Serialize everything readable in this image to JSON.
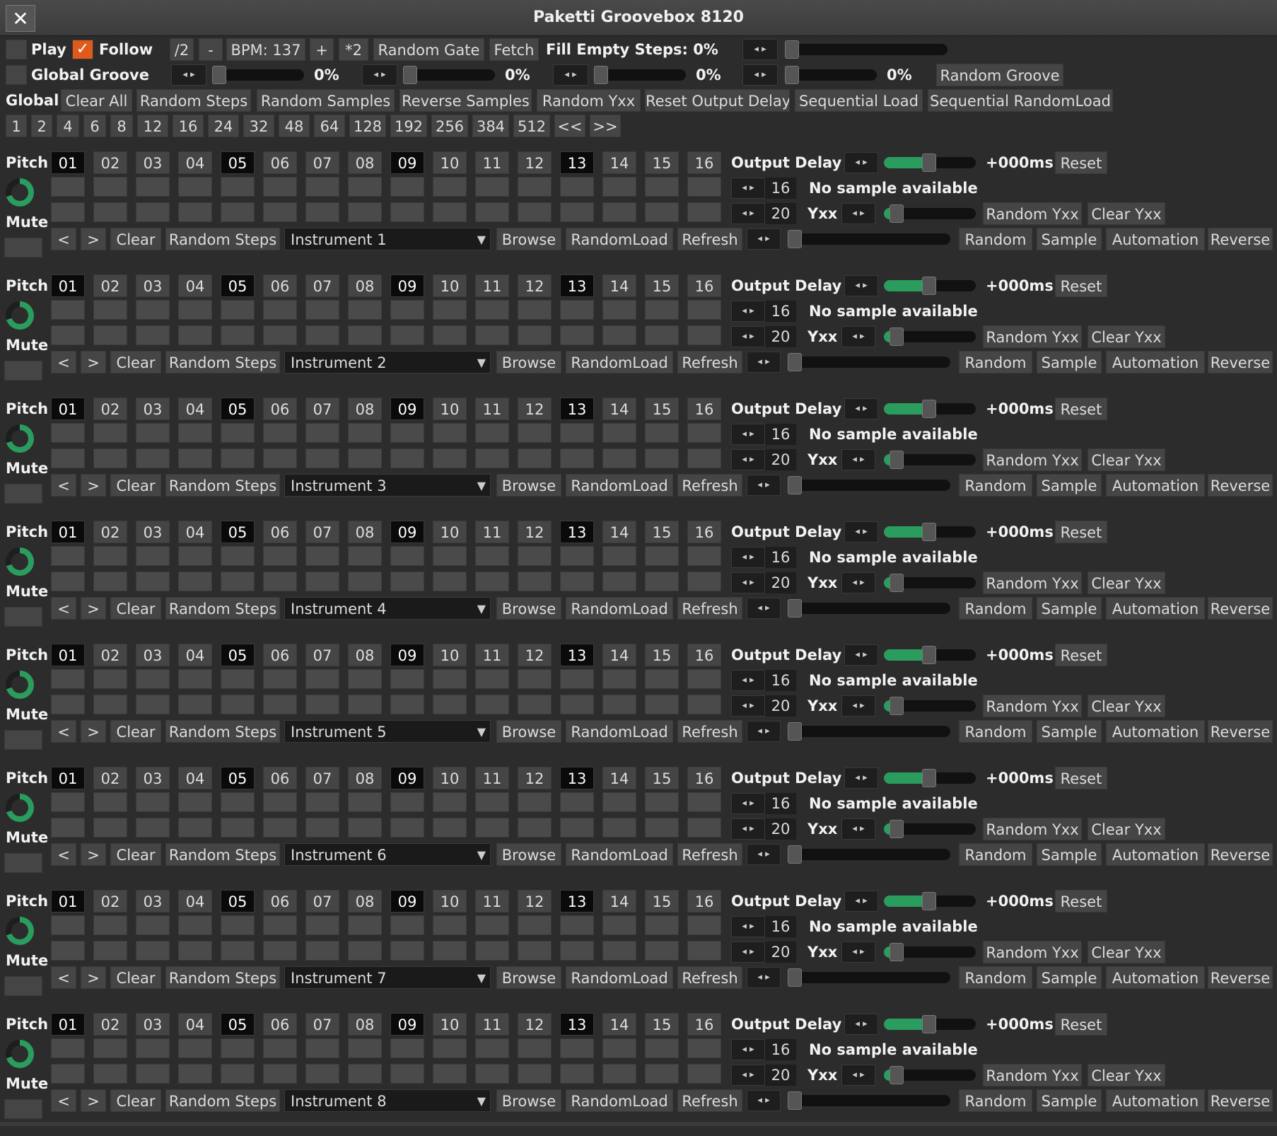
{
  "window": {
    "title": "Paketti Groovebox 8120",
    "close_glyph": "✕"
  },
  "top": {
    "play_label": "Play",
    "play_checked": false,
    "follow_label": "Follow",
    "follow_checked": true,
    "half": "/2",
    "minus": "-",
    "bpm": "BPM: 137",
    "plus": "+",
    "double": "*2",
    "random_gate": "Random Gate",
    "fetch": "Fetch",
    "fill_empty": "Fill Empty Steps: 0%",
    "fill_empty_value": 0,
    "global_groove_label": "Global Groove",
    "global_groove_checked": false,
    "groove_values": [
      "0%",
      "0%",
      "0%",
      "0%"
    ],
    "random_groove": "Random Groove"
  },
  "global_row": {
    "label": "Global",
    "buttons": [
      "Clear All",
      "Random Steps",
      "Random Samples",
      "Reverse Samples",
      "Random Yxx",
      "Reset Output Delay",
      "Sequential Load",
      "Sequential RandomLoad"
    ]
  },
  "step_counts": [
    "1",
    "2",
    "4",
    "6",
    "8",
    "12",
    "16",
    "24",
    "32",
    "48",
    "64",
    "128",
    "192",
    "256",
    "384",
    "512",
    "<<",
    ">>"
  ],
  "track_labels": {
    "pitch": "Pitch",
    "mute": "Mute",
    "steps": [
      "01",
      "02",
      "03",
      "04",
      "05",
      "06",
      "07",
      "08",
      "09",
      "10",
      "11",
      "12",
      "13",
      "14",
      "15",
      "16"
    ],
    "output_delay": "Output Delay",
    "delay_value": "+000ms",
    "reset": "Reset",
    "step_count": "16",
    "no_sample": "No sample available",
    "yxx_value": "20",
    "yxx": "Yxx",
    "random_yxx": "Random Yxx",
    "clear_yxx": "Clear Yxx",
    "prev": "<",
    "next": ">",
    "clear": "Clear",
    "random_steps": "Random Steps",
    "browse": "Browse",
    "random_load": "RandomLoad",
    "refresh": "Refresh",
    "random": "Random",
    "sample": "Sample",
    "automation": "Automation",
    "reverse": "Reverse",
    "dropdown_arrow": "▼",
    "arrows_glyph": "◂ ▸"
  },
  "tracks": [
    {
      "instrument": "Instrument 1"
    },
    {
      "instrument": "Instrument 2"
    },
    {
      "instrument": "Instrument 3"
    },
    {
      "instrument": "Instrument 4"
    },
    {
      "instrument": "Instrument 5"
    },
    {
      "instrument": "Instrument 6"
    },
    {
      "instrument": "Instrument 7"
    },
    {
      "instrument": "Instrument 8"
    }
  ],
  "colors": {
    "accent_green": "#2a9d5e",
    "follow_orange": "#e05a1c",
    "background": "#2c2c2c"
  }
}
